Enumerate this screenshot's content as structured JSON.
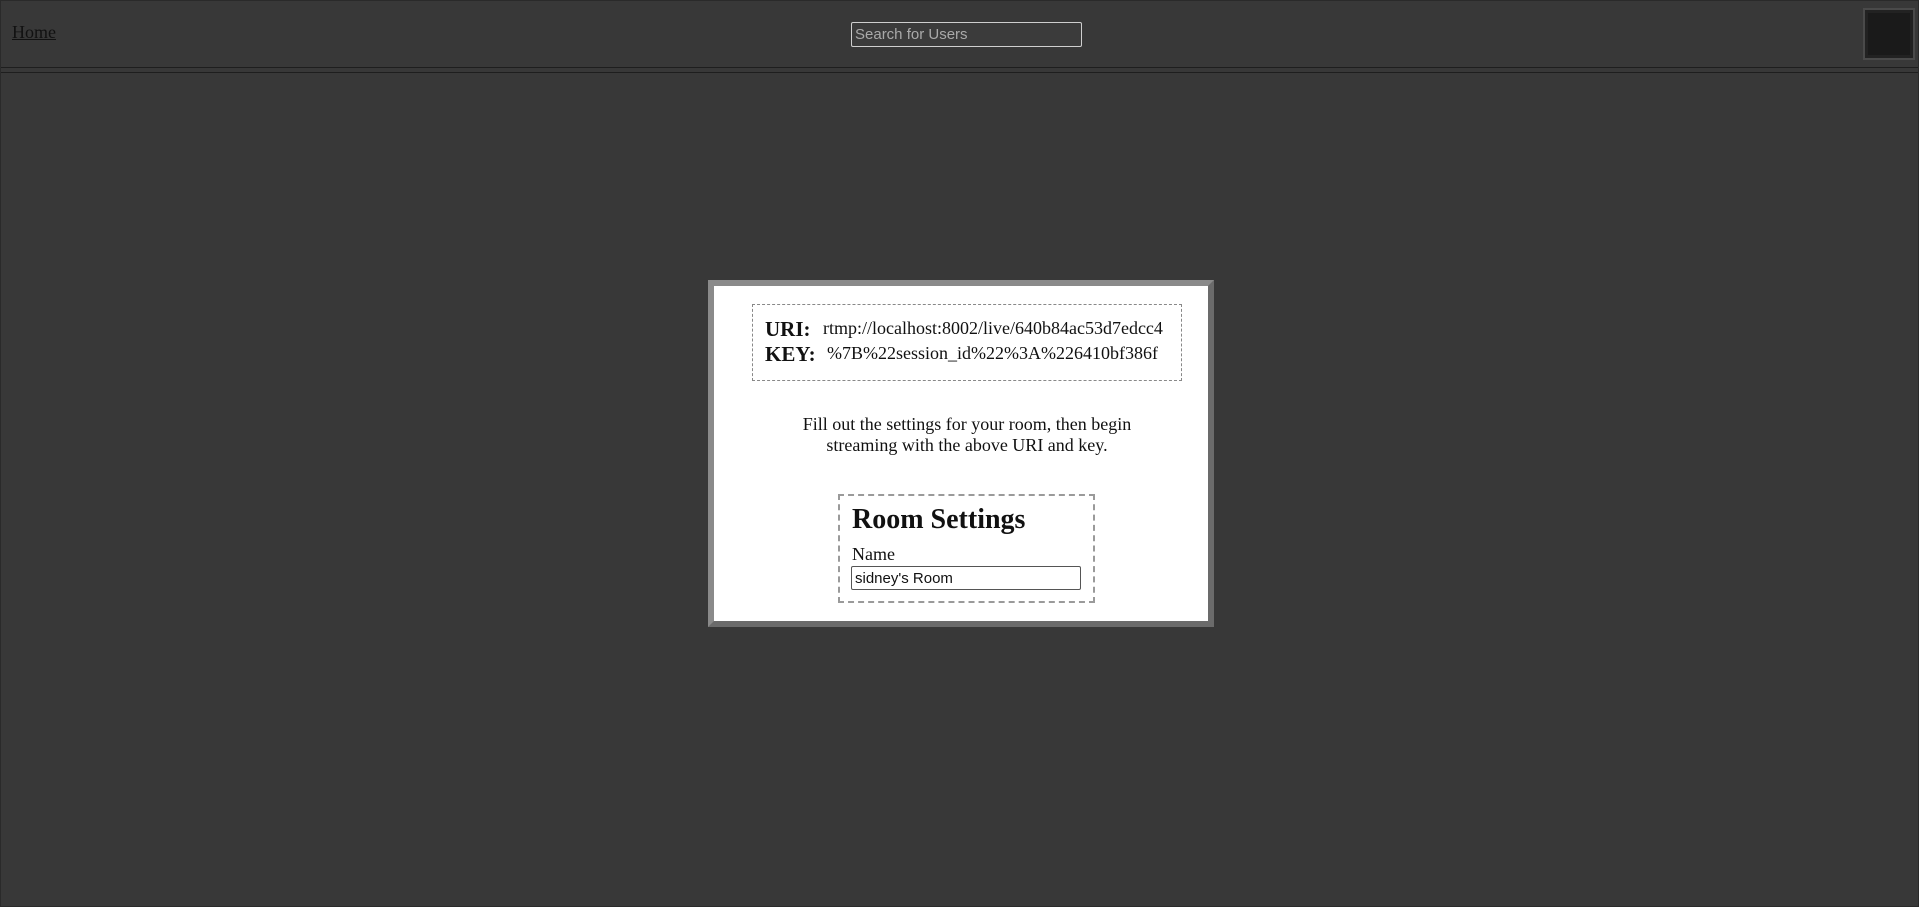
{
  "header": {
    "home_label": "Home",
    "search_placeholder": "Search for Users"
  },
  "modal": {
    "uri_label": "URI:",
    "uri_value": "rtmp://localhost:8002/live/640b84ac53d7edcc4",
    "key_label": "KEY:",
    "key_value": "%7B%22session_id%22%3A%226410bf386f",
    "instructions": "Fill out the settings for your room, then begin streaming with the above URI and key.",
    "settings": {
      "title": "Room Settings",
      "name_label": "Name",
      "name_value": "sidney's Room"
    }
  },
  "colors": {
    "background": "#383838",
    "modal_border": "#6b6b6b",
    "modal_background": "#ffffff"
  }
}
